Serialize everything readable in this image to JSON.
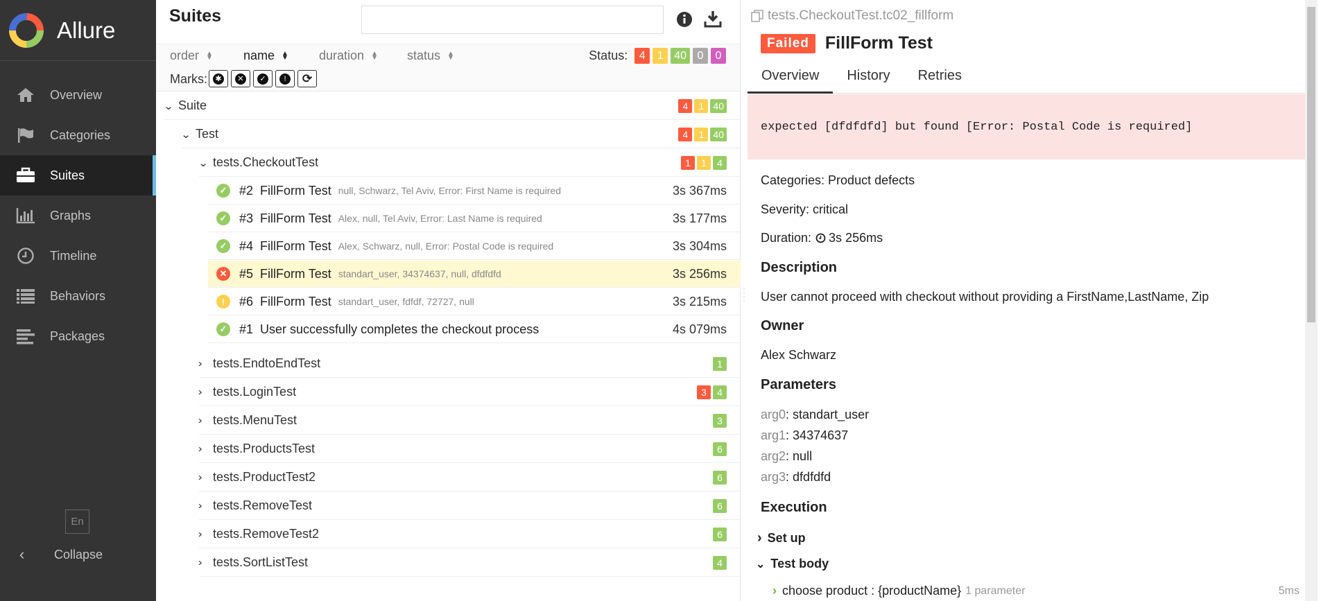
{
  "app": {
    "brand": "Allure",
    "colors": {
      "failed": "#fd5a3e",
      "broken": "#ffd050",
      "passed": "#97cc64",
      "skipped": "#aaaaaa",
      "unknown": "#d35ebe",
      "sidebar": "#343434",
      "accent": "#6dbde6"
    }
  },
  "sidebar": {
    "items": [
      {
        "label": "Overview",
        "icon": "home-icon"
      },
      {
        "label": "Categories",
        "icon": "flag-icon"
      },
      {
        "label": "Suites",
        "icon": "briefcase-icon"
      },
      {
        "label": "Graphs",
        "icon": "bar-chart-icon"
      },
      {
        "label": "Timeline",
        "icon": "clock-icon"
      },
      {
        "label": "Behaviors",
        "icon": "list-icon"
      },
      {
        "label": "Packages",
        "icon": "align-left-icon"
      }
    ],
    "language": "En",
    "collapse": "Collapse"
  },
  "suites": {
    "title": "Suites",
    "sort": {
      "order": "order",
      "name": "name",
      "duration": "duration",
      "status": "status"
    },
    "status_label": "Status:",
    "status_counts": [
      "4",
      "1",
      "40",
      "0",
      "0"
    ],
    "marks_label": "Marks:",
    "tree": {
      "suite": {
        "name": "Suite",
        "counts": [
          "4",
          "1",
          "40"
        ]
      },
      "test": {
        "name": "Test",
        "counts": [
          "4",
          "1",
          "40"
        ]
      },
      "checkout": {
        "name": "tests.CheckoutTest",
        "counts": [
          "1",
          "1",
          "4"
        ]
      },
      "tests": [
        {
          "num": "#2",
          "title": "FillForm Test",
          "params": "null, Schwarz, Tel Aviv, Error: First Name is required",
          "duration": "3s 367ms",
          "status": "passed"
        },
        {
          "num": "#3",
          "title": "FillForm Test",
          "params": "Alex, null, Tel Aviv, Error: Last Name is required",
          "duration": "3s 177ms",
          "status": "passed"
        },
        {
          "num": "#4",
          "title": "FillForm Test",
          "params": "Alex, Schwarz, null, Error: Postal Code is required",
          "duration": "3s 304ms",
          "status": "passed"
        },
        {
          "num": "#5",
          "title": "FillForm Test",
          "params": "standart_user, 34374637, null, dfdfdfd",
          "duration": "3s 256ms",
          "status": "failed"
        },
        {
          "num": "#6",
          "title": "FillForm Test",
          "params": "standart_user, fdfdf, 72727, null",
          "duration": "3s 215ms",
          "status": "broken"
        },
        {
          "num": "#1",
          "title": "User successfully completes the checkout process",
          "params": "",
          "duration": "4s 079ms",
          "status": "passed"
        }
      ],
      "groups": [
        {
          "name": "tests.EndtoEndTest",
          "counts": [
            {
              "v": "1",
              "c": "green"
            }
          ]
        },
        {
          "name": "tests.LoginTest",
          "counts": [
            {
              "v": "3",
              "c": "red"
            },
            {
              "v": "4",
              "c": "green"
            }
          ]
        },
        {
          "name": "tests.MenuTest",
          "counts": [
            {
              "v": "3",
              "c": "green"
            }
          ]
        },
        {
          "name": "tests.ProductsTest",
          "counts": [
            {
              "v": "6",
              "c": "green"
            }
          ]
        },
        {
          "name": "tests.ProductTest2",
          "counts": [
            {
              "v": "6",
              "c": "green"
            }
          ]
        },
        {
          "name": "tests.RemoveTest",
          "counts": [
            {
              "v": "6",
              "c": "green"
            }
          ]
        },
        {
          "name": "tests.RemoveTest2",
          "counts": [
            {
              "v": "6",
              "c": "green"
            }
          ]
        },
        {
          "name": "tests.SortListTest",
          "counts": [
            {
              "v": "4",
              "c": "green"
            }
          ]
        }
      ]
    }
  },
  "detail": {
    "breadcrumb": "tests.CheckoutTest.tc02_fillform",
    "status_tag": "Failed",
    "title": "FillForm Test",
    "tabs": [
      "Overview",
      "History",
      "Retries"
    ],
    "error": "expected [dfdfdfd] but found [Error: Postal Code is required]",
    "categories": "Categories: Product defects",
    "severity": "Severity: critical",
    "duration_label": "Duration:",
    "duration": "3s 256ms",
    "description_h": "Description",
    "description": "User cannot proceed with checkout without providing a FirstName,LastName, Zip",
    "owner_h": "Owner",
    "owner": "Alex Schwarz",
    "parameters_h": "Parameters",
    "parameters": [
      {
        "name": "arg0",
        "value": "standart_user"
      },
      {
        "name": "arg1",
        "value": "34374637"
      },
      {
        "name": "arg2",
        "value": "null"
      },
      {
        "name": "arg3",
        "value": "dfdfdfd"
      }
    ],
    "execution_h": "Execution",
    "setup": "Set up",
    "test_body": "Test body",
    "step": {
      "name": "choose product : {productName}",
      "params": "1 parameter",
      "duration": "5ms"
    }
  }
}
